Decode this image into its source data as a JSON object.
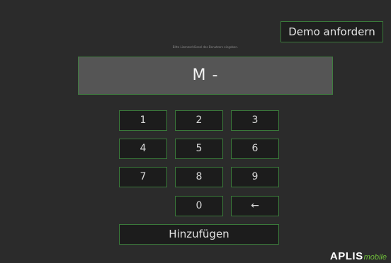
{
  "demo_button": {
    "label": "Demo anfordern"
  },
  "prompt_text": "Bitte Lizenzschlüssel des Benutzers eingeben.",
  "display": {
    "value": "M -"
  },
  "keypad": {
    "k1": "1",
    "k2": "2",
    "k3": "3",
    "k4": "4",
    "k5": "5",
    "k6": "6",
    "k7": "7",
    "k8": "8",
    "k9": "9",
    "k0": "0",
    "backspace": "←"
  },
  "add_button": {
    "label": "Hinzufügen"
  },
  "logo": {
    "main": "APLIS",
    "sub": "mobile"
  }
}
